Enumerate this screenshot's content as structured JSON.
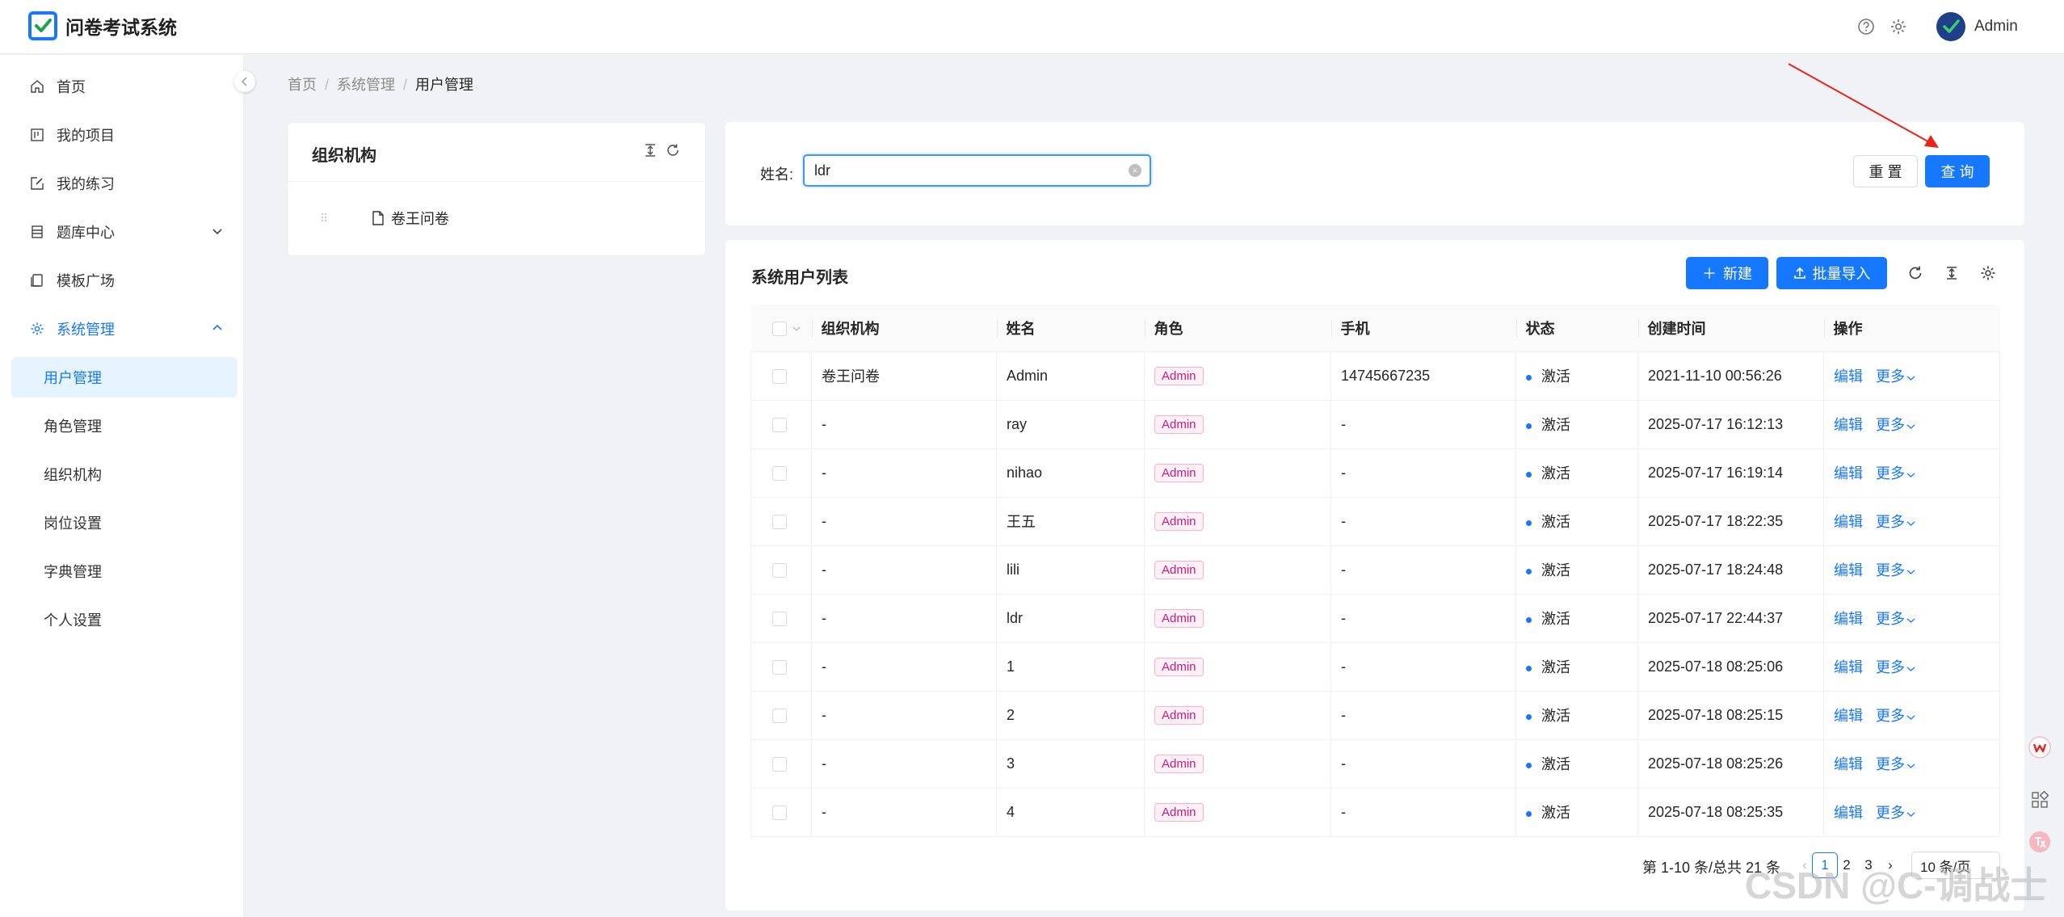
{
  "header": {
    "title": "问卷考试系统",
    "user": "Admin"
  },
  "sidebar": {
    "items": [
      {
        "label": "首页",
        "icon": "home-icon"
      },
      {
        "label": "我的项目",
        "icon": "project-icon"
      },
      {
        "label": "我的练习",
        "icon": "edit-icon"
      },
      {
        "label": "题库中心",
        "icon": "database-icon"
      },
      {
        "label": "模板广场",
        "icon": "template-icon"
      },
      {
        "label": "系统管理",
        "icon": "settings-icon"
      }
    ],
    "sub_items": [
      "用户管理",
      "角色管理",
      "组织机构",
      "岗位设置",
      "字典管理",
      "个人设置"
    ],
    "selected": "用户管理"
  },
  "breadcrumb": [
    "首页",
    "系统管理",
    "用户管理"
  ],
  "org": {
    "title": "组织机构",
    "node": "卷王问卷"
  },
  "search": {
    "label": "姓名:",
    "value": "ldr",
    "reset_label": "重 置",
    "query_label": "查 询"
  },
  "table": {
    "title": "系统用户列表",
    "new_label": "新建",
    "import_label": "批量导入",
    "columns": [
      "组织机构",
      "姓名",
      "角色",
      "手机",
      "状态",
      "创建时间",
      "操作"
    ],
    "edit_label": "编辑",
    "more_label": "更多",
    "rows": [
      {
        "org": "卷王问卷",
        "name": "Admin",
        "role": "Admin",
        "phone": "14745667235",
        "status": "激活",
        "created": "2021-11-10 00:56:26"
      },
      {
        "org": "-",
        "name": "ray",
        "role": "Admin",
        "phone": "-",
        "status": "激活",
        "created": "2025-07-17 16:12:13"
      },
      {
        "org": "-",
        "name": "nihao",
        "role": "Admin",
        "phone": "-",
        "status": "激活",
        "created": "2025-07-17 16:19:14"
      },
      {
        "org": "-",
        "name": "王五",
        "role": "Admin",
        "phone": "-",
        "status": "激活",
        "created": "2025-07-17 18:22:35"
      },
      {
        "org": "-",
        "name": "lili",
        "role": "Admin",
        "phone": "-",
        "status": "激活",
        "created": "2025-07-17 18:24:48"
      },
      {
        "org": "-",
        "name": "ldr",
        "role": "Admin",
        "phone": "-",
        "status": "激活",
        "created": "2025-07-17 22:44:37"
      },
      {
        "org": "-",
        "name": "1",
        "role": "Admin",
        "phone": "-",
        "status": "激活",
        "created": "2025-07-18 08:25:06"
      },
      {
        "org": "-",
        "name": "2",
        "role": "Admin",
        "phone": "-",
        "status": "激活",
        "created": "2025-07-18 08:25:15"
      },
      {
        "org": "-",
        "name": "3",
        "role": "Admin",
        "phone": "-",
        "status": "激活",
        "created": "2025-07-18 08:25:26"
      },
      {
        "org": "-",
        "name": "4",
        "role": "Admin",
        "phone": "-",
        "status": "激活",
        "created": "2025-07-18 08:25:35"
      }
    ]
  },
  "pagination": {
    "total_text": "第 1-10 条/总共 21 条",
    "pages": [
      "1",
      "2",
      "3"
    ],
    "current": "1",
    "page_size": "10 条/页"
  },
  "watermark": "CSDN @C-调战士",
  "colors": {
    "primary": "#1677ff",
    "tag_text": "#c41d7f",
    "annotation": "#e8231b"
  }
}
